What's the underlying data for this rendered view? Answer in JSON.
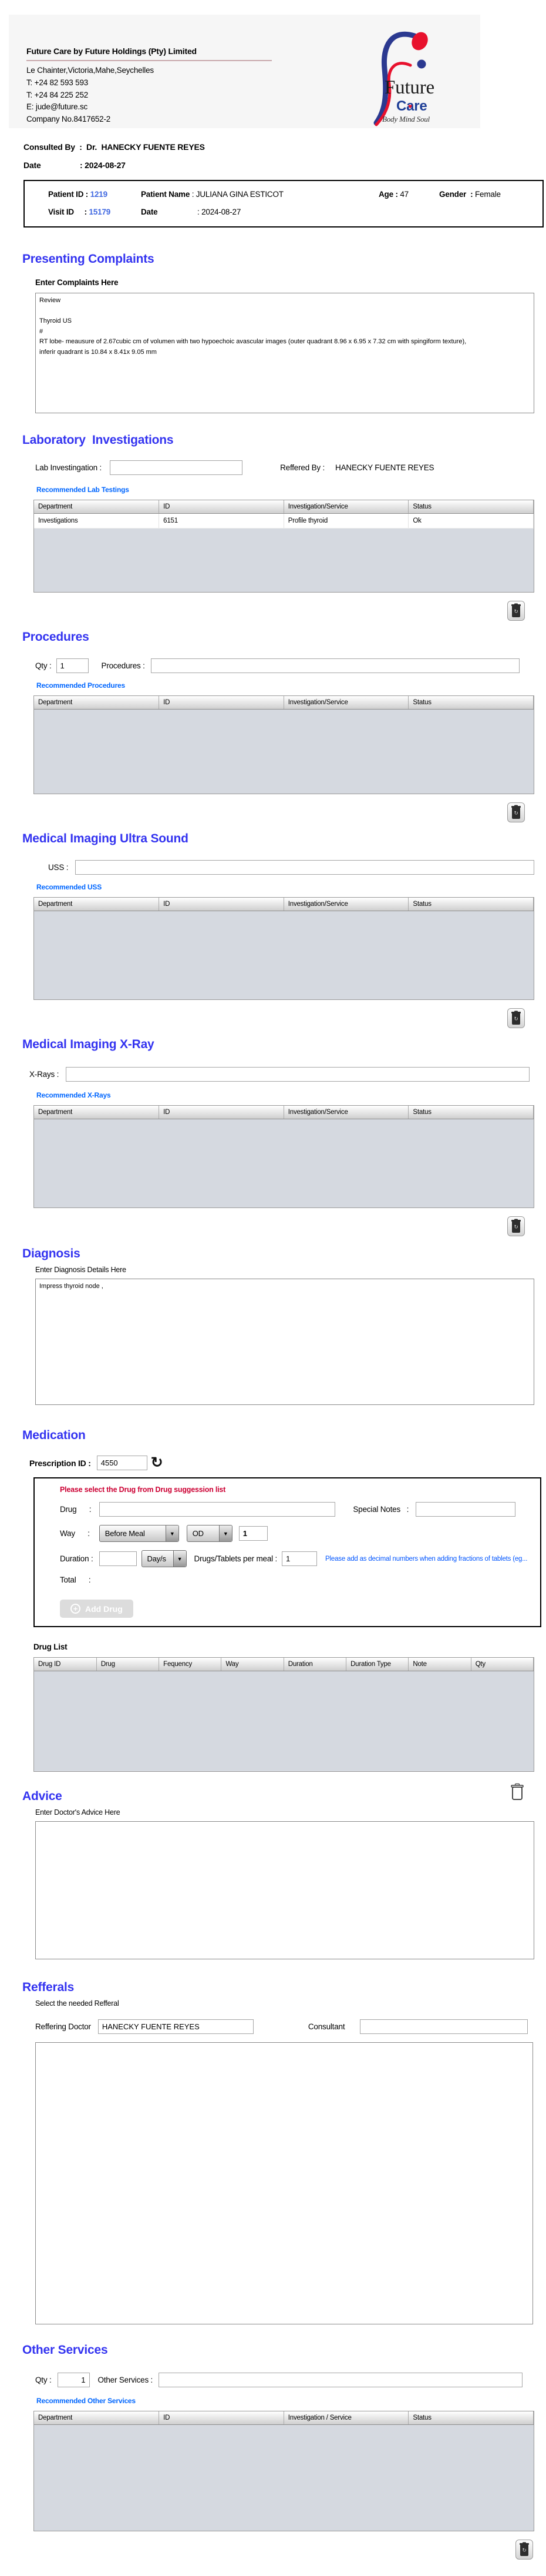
{
  "icons": {
    "dropdown_arrow": "▼",
    "add": "+",
    "refresh": "↻"
  },
  "header": {
    "company_name": "Future Care by Future Holdings (Pty) Limited",
    "address": "Le Chainter,Victoria,Mahe,Seychelles",
    "phone1": "T: +24  82 593 593",
    "phone2": "T: +24  84 225 252",
    "email": "E: jude@future.sc",
    "company_no": "Company No.8417652-2",
    "logo_word1": "Future",
    "logo_word2": "Care",
    "logo_tagline": "Body Mind Soul"
  },
  "consult": {
    "consulted_by_label": "Consulted By  :  Dr.  ",
    "consulted_by_value": "HANECKY FUENTE REYES",
    "date_label": "Date",
    "date_value": ": 2024-08-27"
  },
  "patient": {
    "patient_id_label": "Patient ID : ",
    "patient_id": "1219",
    "patient_name_label": "Patient Name ",
    "patient_name": ": JULIANA GINA ESTICOT",
    "age_label": "Age : ",
    "age": "47",
    "gender_label": "Gender  : ",
    "gender": "Female",
    "visit_id_label": "Visit ID     : ",
    "visit_id": "15179",
    "visit_date_label": "Date",
    "visit_date": ": 2024-08-27"
  },
  "complaints": {
    "title": "Presenting Complaints",
    "label": "Enter Complaints Here",
    "text": "Review\n\nThyroid US\n#\nRT lobe- meausure of 2.67cubic cm of volumen with two hypoechoic avascular images (outer quadrant 8.96 x 6.95 x 7.32 cm with spingiform texture),\ninferir quadrant is 10.84 x 8.41x 9.05 mm"
  },
  "laboratory": {
    "title": "Laboratory  Investigations",
    "input_label": "Lab Investingation :",
    "input_value": "",
    "referred_label": "Reffered By :",
    "referred_value": "HANECKY FUENTE REYES",
    "link": "Recommended Lab Testings",
    "table": {
      "headers": [
        "Department",
        "ID",
        "Investigation/Service",
        "Status"
      ],
      "rows": [
        [
          "Investigations",
          "6151",
          "Profile thyroid",
          "Ok"
        ]
      ]
    }
  },
  "procedures": {
    "title": "Procedures",
    "qty_label": "Qty :",
    "qty_value": "1",
    "input_label": "Procedures :",
    "input_value": "",
    "link": "Recommended Procedures",
    "table": {
      "headers": [
        "Department",
        "ID",
        "Investigation/Service",
        "Status"
      ],
      "rows": []
    }
  },
  "uss": {
    "title": "Medical Imaging Ultra Sound",
    "input_label": "USS :",
    "input_value": "",
    "link": "Recommended USS",
    "table": {
      "headers": [
        "Department",
        "ID",
        "Investigation/Service",
        "Status"
      ],
      "rows": []
    }
  },
  "xray": {
    "title": "Medical Imaging X-Ray",
    "input_label": "X-Rays :",
    "input_value": "",
    "link": "Recommended X-Rays",
    "table": {
      "headers": [
        "Department",
        "ID",
        "Investigation/Service",
        "Status"
      ],
      "rows": []
    }
  },
  "diagnosis": {
    "title": "Diagnosis",
    "label": "Enter Diagnosis Details Here",
    "text": "Impress thyroid node ,"
  },
  "medication": {
    "title": "Medication",
    "prescription_label": "Prescription ID :",
    "prescription_id": "4550",
    "alert": "Please select the Drug from Drug suggession list",
    "drug_label": "Drug      :",
    "drug_value": "",
    "special_notes_label": "Special Notes   :",
    "special_notes_value": "",
    "way_label": "Way      :",
    "meal_select_value": "Before Meal",
    "freq_select_value": "OD",
    "freq_qty_value": "1",
    "duration_label": "Duration :",
    "duration_value": "",
    "duration_unit_value": "Day/s",
    "per_meal_label": "Drugs/Tablets per meal :",
    "per_meal_value": "1",
    "decimal_note": "Please add as decimal numbers when adding fractions of tablets (eg...",
    "total_label": "Total      :",
    "add_drug_label": "Add Drug",
    "drug_list_label": "Drug List",
    "table": {
      "headers": [
        "Drug ID",
        "Drug",
        "Fequency",
        "Way",
        "Duration",
        "Duration Type",
        "Note",
        "Qty"
      ],
      "rows": []
    }
  },
  "advice": {
    "title": "Advice",
    "label": "Enter Doctor's Advice Here",
    "text": ""
  },
  "referrals": {
    "title": "Refferals",
    "label": "Select the needed Refferal",
    "referring_label": "Reffering Doctor",
    "referring_value": "HANECKY FUENTE REYES",
    "consultant_label": "Consultant",
    "consultant_value": ""
  },
  "other_services": {
    "title": "Other Services",
    "qty_label": "Qty :",
    "qty_value": "1",
    "input_label": "Other Services :",
    "input_value": "",
    "link": "Recommended Other Services",
    "table": {
      "headers": [
        "Department",
        "ID",
        "Investigation / Service",
        "Status"
      ],
      "rows": []
    }
  }
}
